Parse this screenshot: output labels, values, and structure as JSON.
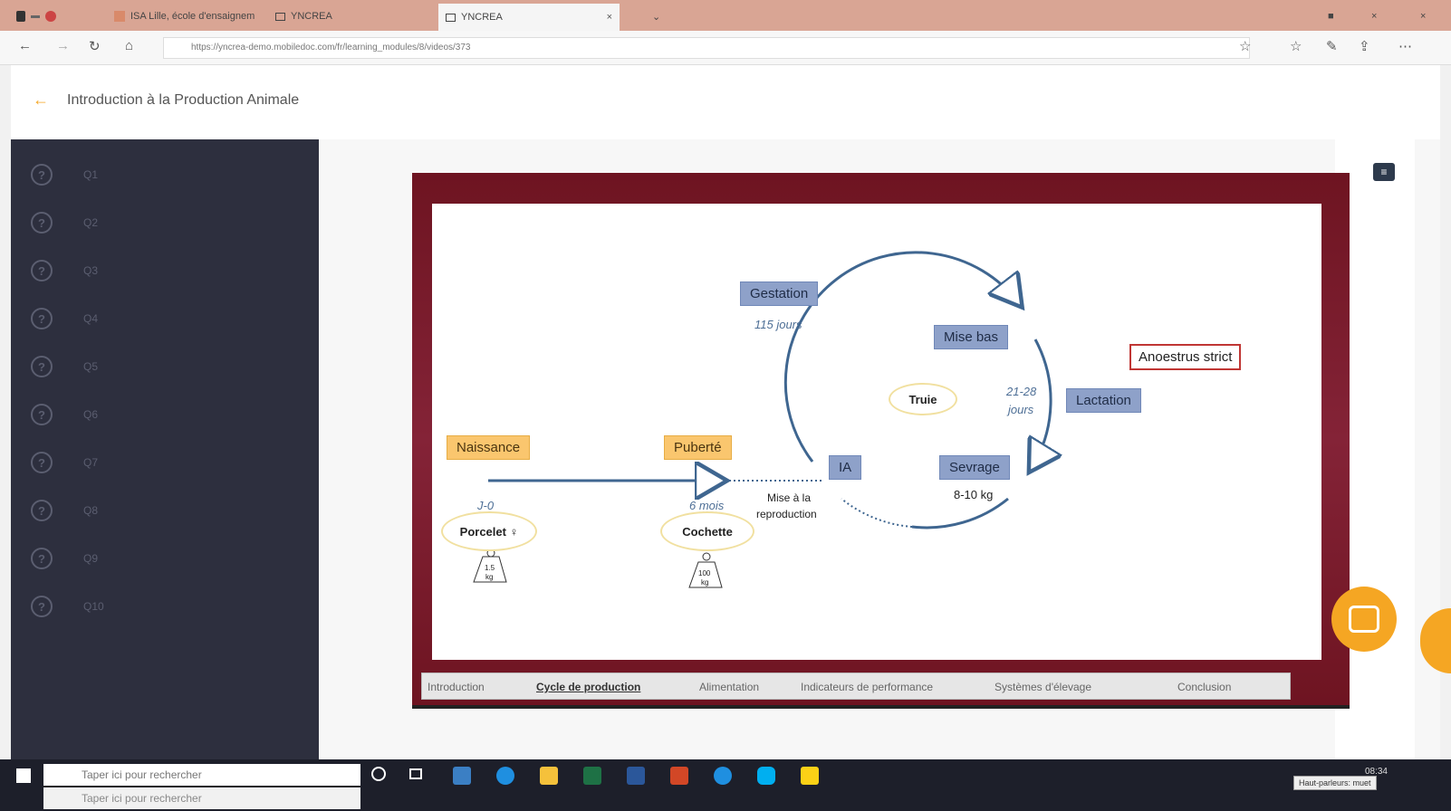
{
  "browser": {
    "tabs": [
      {
        "label": "ISA Lille, école d'ensaignem"
      },
      {
        "label": "YNCREA"
      },
      {
        "label": "YNCREA"
      }
    ],
    "url": "https://yncrea-demo.mobiledoc.com/fr/learning_modules/8/videos/373"
  },
  "app": {
    "title": "Introduction à la Production Animale"
  },
  "sidebar": {
    "items": [
      {
        "label": "Q1"
      },
      {
        "label": "Q2"
      },
      {
        "label": "Q3"
      },
      {
        "label": "Q4"
      },
      {
        "label": "Q5"
      },
      {
        "label": "Q6"
      },
      {
        "label": "Q7"
      },
      {
        "label": "Q8"
      },
      {
        "label": "Q9"
      },
      {
        "label": "Q10"
      }
    ]
  },
  "slide": {
    "gestation": "Gestation",
    "gestation_days": "115 jours",
    "mise_bas": "Mise bas",
    "lactation": "Lactation",
    "lactation_days_1": "21-28",
    "lactation_days_2": "jours",
    "anoestrus": "Anoestrus strict",
    "truie": "Truie",
    "sevrage": "Sevrage",
    "sevrage_weight": "8-10 kg",
    "ia": "IA",
    "naissance": "Naissance",
    "naissance_day": "J-0",
    "puberte": "Puberté",
    "puberte_age": "6 mois",
    "mise_repro_1": "Mise à la",
    "mise_repro_2": "reproduction",
    "porcelet": "Porcelet ♀",
    "cochette": "Cochette",
    "weight_porcelet_1": "1.5",
    "weight_porcelet_2": "kg",
    "weight_cochette_1": "100",
    "weight_cochette_2": "kg"
  },
  "slide_nav": {
    "items": [
      {
        "label": "Introduction"
      },
      {
        "label": "Cycle de production"
      },
      {
        "label": "Alimentation"
      },
      {
        "label": "Indicateurs de performance"
      },
      {
        "label": "Systèmes d'élevage"
      },
      {
        "label": "Conclusion"
      }
    ],
    "active_index": 1
  },
  "taskbar": {
    "search_placeholder": "Taper ici pour rechercher",
    "time": "08:34",
    "tooltip": "Haut-parleurs: muet"
  },
  "colors": {
    "accent": "#f5a623",
    "sidebar_bg": "#2d2f3e",
    "slide_frame": "#7a1a2c",
    "label_blue": "#8ea1c9",
    "label_yellow": "#fac66e",
    "cycle_line": "#3f6690"
  },
  "icons": {
    "back": "arrow-left-icon",
    "comment": "comment-icon",
    "chat": "chat-bubble-icon",
    "question": "question-circle-icon"
  }
}
